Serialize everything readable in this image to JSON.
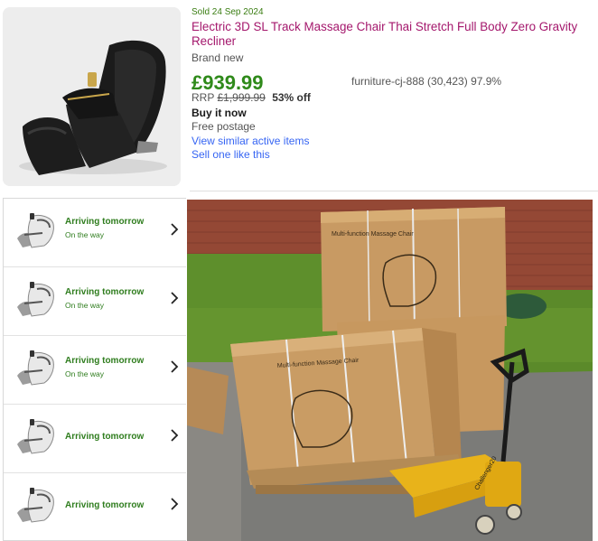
{
  "listing": {
    "sold_date": "Sold 24 Sep 2024",
    "title": "Electric 3D SL Track Massage Chair Thai Stretch Full Body Zero Gravity Recliner",
    "condition": "Brand new",
    "price": "£939.99",
    "seller": "furniture-cj-888 (30,423) 97.9%",
    "rrp_label": "RRP",
    "rrp_value": "£1,999.99",
    "discount": "53% off",
    "buying_format": "Buy it now",
    "postage": "Free postage",
    "view_similar": "View similar active items",
    "sell_one": "Sell one like this",
    "colors": {
      "title": "#a4176c",
      "price": "#2f8a1a",
      "link": "#3665f3"
    }
  },
  "deliveries": [
    {
      "status": "Arriving tomorrow",
      "sub": "On the way"
    },
    {
      "status": "Arriving tomorrow",
      "sub": "On the way"
    },
    {
      "status": "Arriving tomorrow",
      "sub": "On the way"
    },
    {
      "status": "Arriving tomorrow",
      "sub": ""
    },
    {
      "status": "Arriving tomorrow",
      "sub": ""
    }
  ],
  "photo": {
    "box_label": "Multi-function Massage Chair",
    "pallet_truck_label": "Challenger20"
  },
  "icons": {
    "delivery_thumb": "massage-chair-thumbnail-icon",
    "chevron": "chevron-right-icon"
  }
}
